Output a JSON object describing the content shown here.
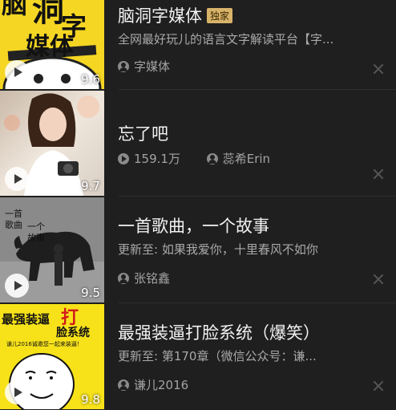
{
  "items": [
    {
      "title": "脑洞字媒体",
      "badge": "独家",
      "subtitle": "全网最好玩儿的语言文字解读平台【字...",
      "author": "字媒体",
      "rating": "9.6",
      "cover_text": [
        "脑",
        "洞",
        "字",
        "媒体"
      ],
      "icons": [
        "user-icon",
        "close-icon",
        "play-icon"
      ]
    },
    {
      "title": "忘了吧",
      "plays": "159.1万",
      "author": "蕊希Erin",
      "rating": "9.7",
      "icons": [
        "play-count-icon",
        "user-icon",
        "close-icon",
        "play-icon"
      ]
    },
    {
      "title": "一首歌曲，一个故事",
      "subtitle": "更新至: 如果我爱你，十里春风不如你",
      "author": "张铭鑫",
      "rating": "9.5",
      "cover_text": [
        "一首",
        "歌曲",
        "一个",
        "故事"
      ],
      "icons": [
        "user-icon",
        "close-icon",
        "play-icon"
      ]
    },
    {
      "title": "最强装逼打脸系统（爆笑）",
      "subtitle": "更新至: 第170章（微信公众号：谦...",
      "author": "谦儿2016",
      "rating": "9.8",
      "cover_text": [
        "最强装逼",
        "打",
        "脸系统",
        "谦儿2016诚邀您一起来装逼！"
      ],
      "icons": [
        "user-icon",
        "close-icon",
        "play-icon"
      ]
    }
  ],
  "colors": {
    "background": "#1f1f1f",
    "badge": "#d8b36a",
    "cover1": "#f5d623",
    "cover4": "#f7e21a"
  }
}
